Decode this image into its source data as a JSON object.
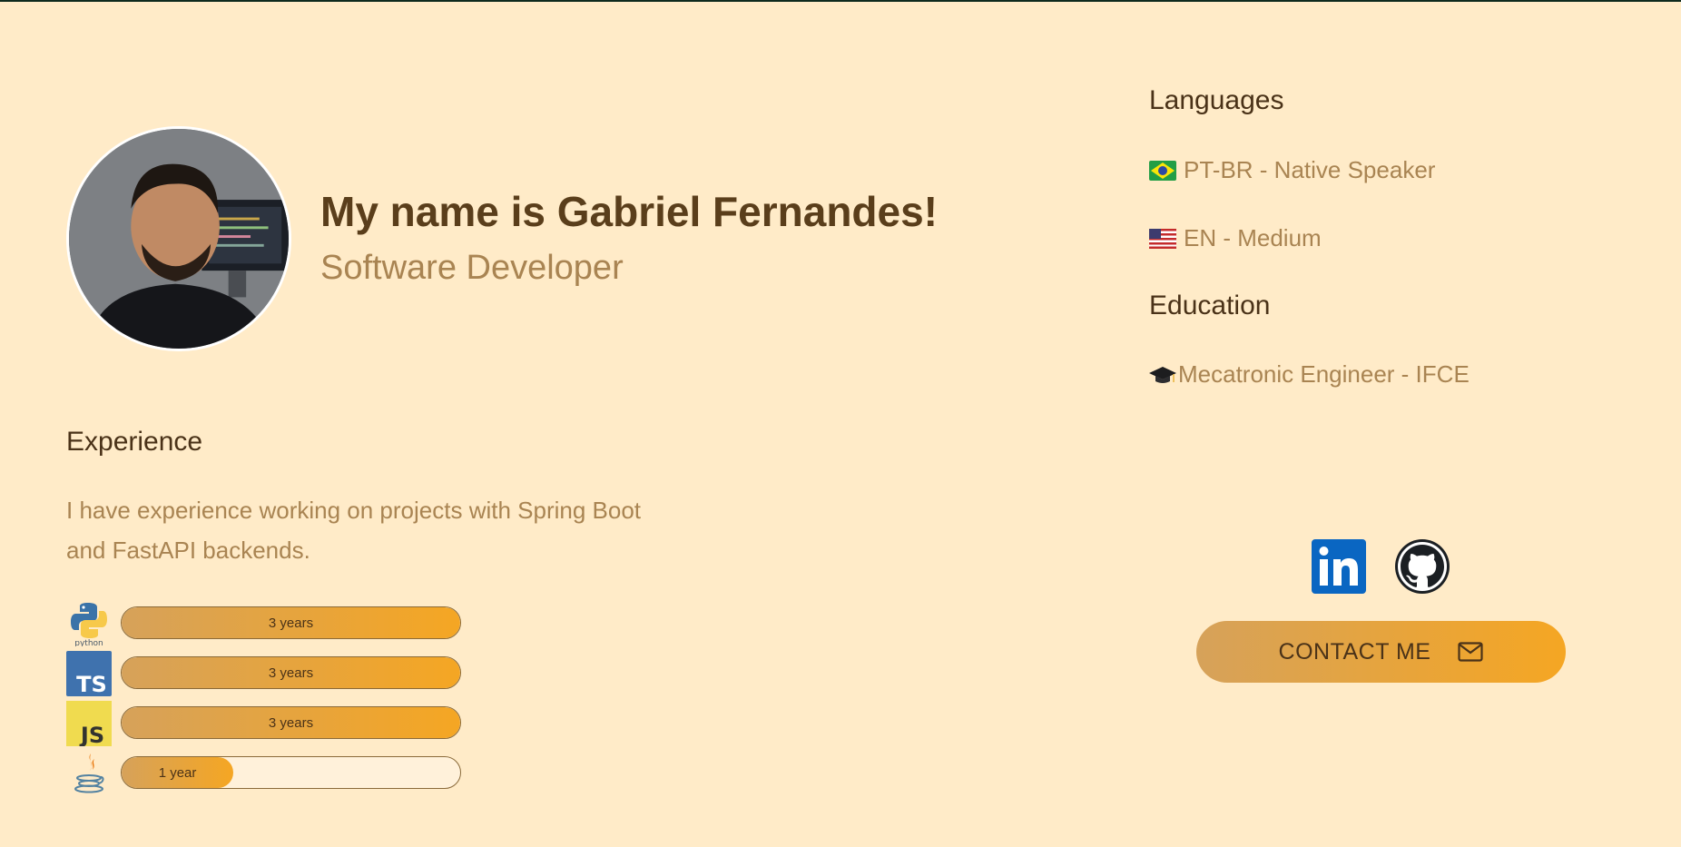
{
  "profile": {
    "name": "My name is Gabriel Fernandes!",
    "role": "Software Developer"
  },
  "experience": {
    "title": "Experience",
    "text": "I have experience working on projects with Spring Boot and FastAPI backends.",
    "skills": [
      {
        "icon": "python-logo-icon",
        "label": "3 years",
        "fill_fraction": 1.0
      },
      {
        "icon": "typescript-logo-icon",
        "label": "3 years",
        "fill_fraction": 1.0
      },
      {
        "icon": "javascript-logo-icon",
        "label": "3 years",
        "fill_fraction": 1.0
      },
      {
        "icon": "java-logo-icon",
        "label": "1 year",
        "fill_fraction": 0.33
      }
    ]
  },
  "languages": {
    "title": "Languages",
    "items": [
      {
        "icon": "brazil-flag-icon",
        "label": "PT-BR - Native Speaker"
      },
      {
        "icon": "usa-flag-icon",
        "label": "EN - Medium"
      }
    ]
  },
  "education": {
    "title": "Education",
    "items": [
      {
        "icon": "graduation-cap-icon",
        "label": "Mecatronic Engineer - IFCE"
      }
    ]
  },
  "social": {
    "linkedin_icon": "linkedin-icon",
    "github_icon": "github-icon"
  },
  "contact": {
    "label": "CONTACT ME",
    "icon": "mail-icon"
  },
  "python_logo_text": "python",
  "colors": {
    "background": "#ffebc8",
    "heading": "#5a3e1b",
    "muted": "#a98452",
    "accent_start": "#d6a25a",
    "accent_end": "#f5a623",
    "linkedin": "#0a66c2"
  }
}
